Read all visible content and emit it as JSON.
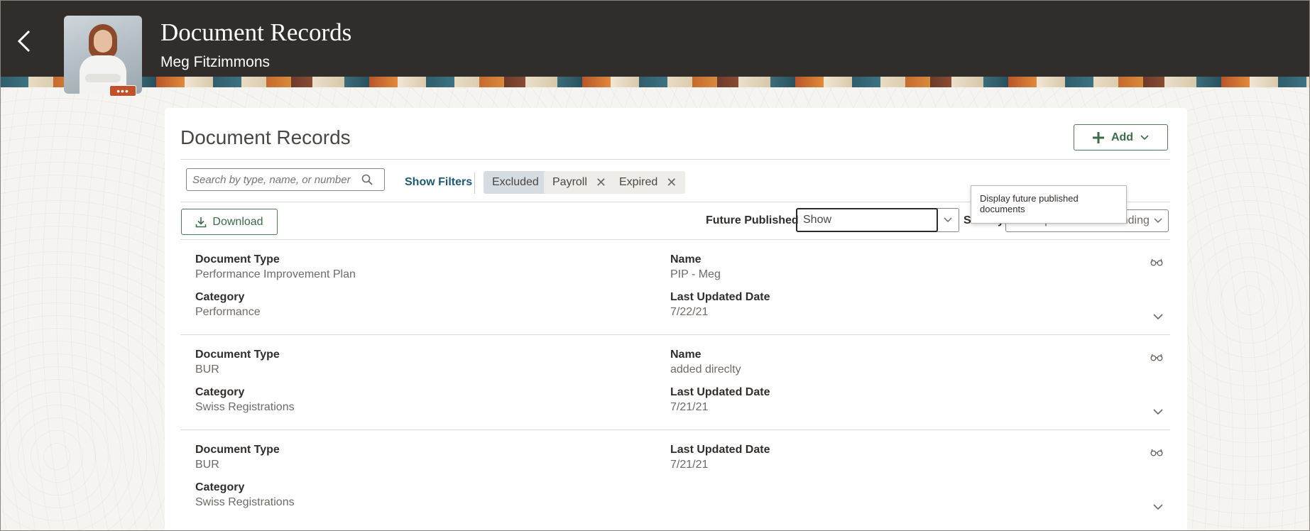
{
  "header": {
    "title": "Document Records",
    "subtitle": "Meg Fitzimmons",
    "more_label": "•••"
  },
  "card": {
    "title": "Document Records",
    "add_label": "Add"
  },
  "toolbar": {
    "search_placeholder": "Search by type, name, or number",
    "show_filters": "Show Filters",
    "chips": [
      {
        "label": "Excluded",
        "removable": false
      },
      {
        "label": "Payroll",
        "removable": true
      },
      {
        "label": "Expired",
        "removable": true
      }
    ],
    "download_label": "Download",
    "future_published_label": "Future Published",
    "future_published_value": "Show",
    "sort_by_label": "Sort By",
    "sort_by_value": "Last Updated - Descending"
  },
  "tooltip": {
    "text": "Display future published documents"
  },
  "records": [
    {
      "doc_type_label": "Document Type",
      "doc_type": "Performance Improvement Plan",
      "category_label": "Category",
      "category": "Performance",
      "name_label": "Name",
      "name": "PIP - Meg",
      "updated_label": "Last Updated Date",
      "updated": "7/22/21"
    },
    {
      "doc_type_label": "Document Type",
      "doc_type": "BUR",
      "category_label": "Category",
      "category": "Swiss Registrations",
      "name_label": "Name",
      "name": "added direclty",
      "updated_label": "Last Updated Date",
      "updated": "7/21/21"
    },
    {
      "doc_type_label": "Document Type",
      "doc_type": "BUR",
      "category_label": "Category",
      "category": "Swiss Registrations",
      "updated_label": "Last Updated Date",
      "updated": "7/21/21"
    }
  ],
  "colors": {
    "banner": "#312d2a",
    "accent_green": "#3b6b47",
    "link_blue": "#1d5a78",
    "chip_selected": "#d5dde2"
  }
}
